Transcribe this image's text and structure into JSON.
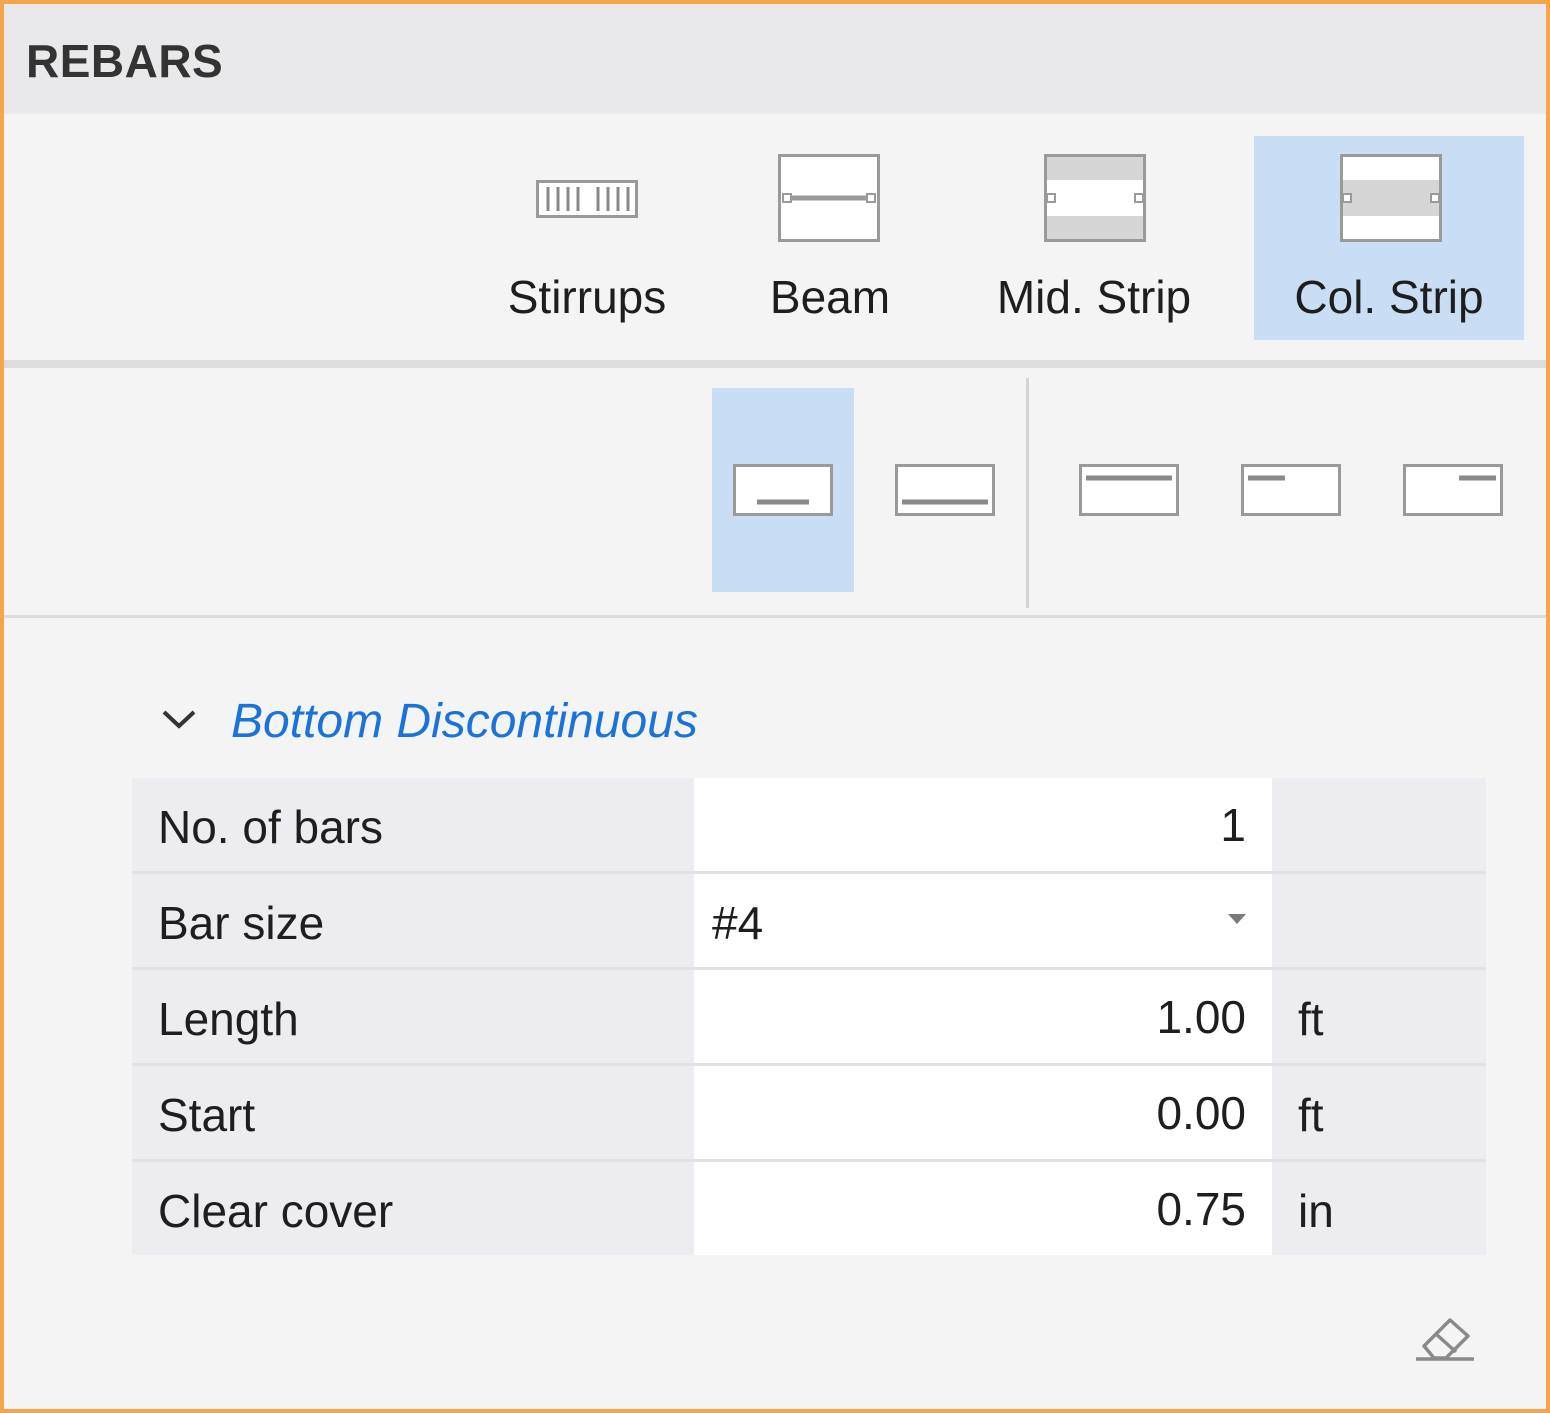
{
  "header": {
    "title": "REBARS"
  },
  "rebar_types": [
    {
      "label": "Stirrups",
      "icon": "stirrups-icon",
      "selected": false
    },
    {
      "label": "Beam",
      "icon": "beam-icon",
      "selected": false
    },
    {
      "label": "Mid. Strip",
      "icon": "mid-strip-icon",
      "selected": false
    },
    {
      "label": "Col. Strip",
      "icon": "col-strip-icon",
      "selected": true
    }
  ],
  "bar_positions": [
    {
      "icon": "bottom-discontinuous-icon",
      "selected": true
    },
    {
      "icon": "bottom-continuous-icon",
      "selected": false
    },
    {
      "icon": "top-continuous-icon",
      "selected": false
    },
    {
      "icon": "top-left-discontinuous-icon",
      "selected": false
    },
    {
      "icon": "top-right-discontinuous-icon",
      "selected": false
    }
  ],
  "section": {
    "title": "Bottom Discontinuous",
    "expanded": true,
    "properties": [
      {
        "label": "No. of bars",
        "value": "1",
        "unit": "",
        "type": "number"
      },
      {
        "label": "Bar size",
        "value": "#4",
        "unit": "",
        "type": "select"
      },
      {
        "label": "Length",
        "value": "1.00",
        "unit": "ft",
        "type": "number"
      },
      {
        "label": "Start",
        "value": "0.00",
        "unit": "ft",
        "type": "number"
      },
      {
        "label": "Clear cover",
        "value": "0.75",
        "unit": "in",
        "type": "number"
      }
    ]
  },
  "footer": {
    "icon": "eraser-icon"
  },
  "colors": {
    "panel_border": "#f5a54a",
    "selected_bg": "#c9ddf4",
    "section_title": "#1a73d9"
  }
}
